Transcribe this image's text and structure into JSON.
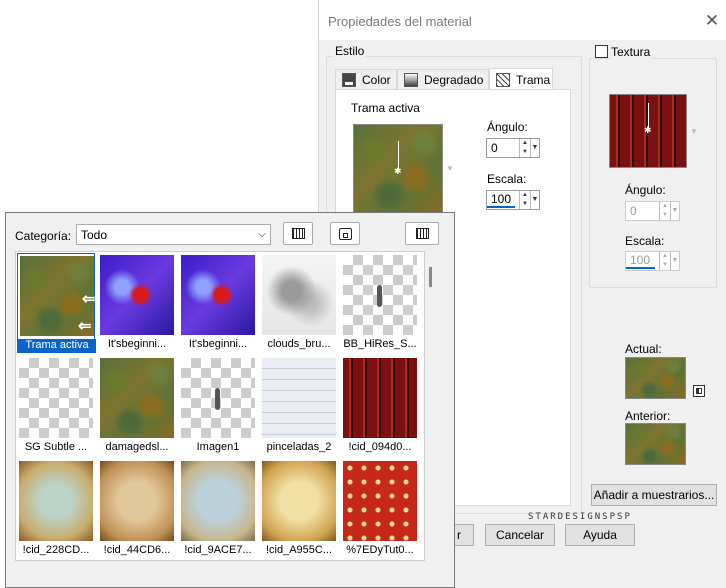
{
  "dialog": {
    "title": "Propiedades del material",
    "estilo_label": "Estilo",
    "tabs": [
      {
        "label": "Color",
        "icon": "color-swatch-icon"
      },
      {
        "label": "Degradado",
        "icon": "gradient-icon"
      },
      {
        "label": "Trama",
        "icon": "pattern-icon"
      }
    ],
    "trama_activa_label": "Trama activa",
    "angulo_label": "Ángulo:",
    "angulo_value": "0",
    "escala_label": "Escala:",
    "escala_value": "100",
    "textura_label": "Textura",
    "textura_checked": false,
    "textura_angulo_label": "Ángulo:",
    "textura_angulo_value": "0",
    "textura_escala_label": "Escala:",
    "textura_escala_value": "100",
    "actual_label": "Actual:",
    "anterior_label": "Anterior:",
    "add_swatches_button": "Añadir a muestrarios...",
    "ok_button_partial": "r",
    "cancel_button": "Cancelar",
    "help_button": "Ayuda",
    "watermark": "STARDESIGNSPSP"
  },
  "catalog": {
    "category_label": "Categoría:",
    "category_value": "Todo",
    "items": [
      {
        "caption": "Trama activa",
        "kind": "texture",
        "selected": true
      },
      {
        "caption": "It'sbeginni...",
        "kind": "xmas"
      },
      {
        "caption": "It'sbeginni...",
        "kind": "xmas"
      },
      {
        "caption": "clouds_bru...",
        "kind": "clouds"
      },
      {
        "caption": "BB_HiRes_S...",
        "kind": "checker-mark"
      },
      {
        "caption": "SG Subtle ...",
        "kind": "checker"
      },
      {
        "caption": "damagedsl...",
        "kind": "texture"
      },
      {
        "caption": "Imagen1",
        "kind": "checker-mark"
      },
      {
        "caption": "pinceladas_2",
        "kind": "screenshot"
      },
      {
        "caption": "!cid_094d0...",
        "kind": "wave"
      },
      {
        "caption": "!cid_228CD...",
        "kind": "paper-blue"
      },
      {
        "caption": "!cid_44CD6...",
        "kind": "paper-tan"
      },
      {
        "caption": "!cid_9ACE7...",
        "kind": "paper-lightblue"
      },
      {
        "caption": "!cid_A955C...",
        "kind": "paper-gold"
      },
      {
        "caption": "%7EDyTut0...",
        "kind": "strawberry"
      }
    ]
  }
}
